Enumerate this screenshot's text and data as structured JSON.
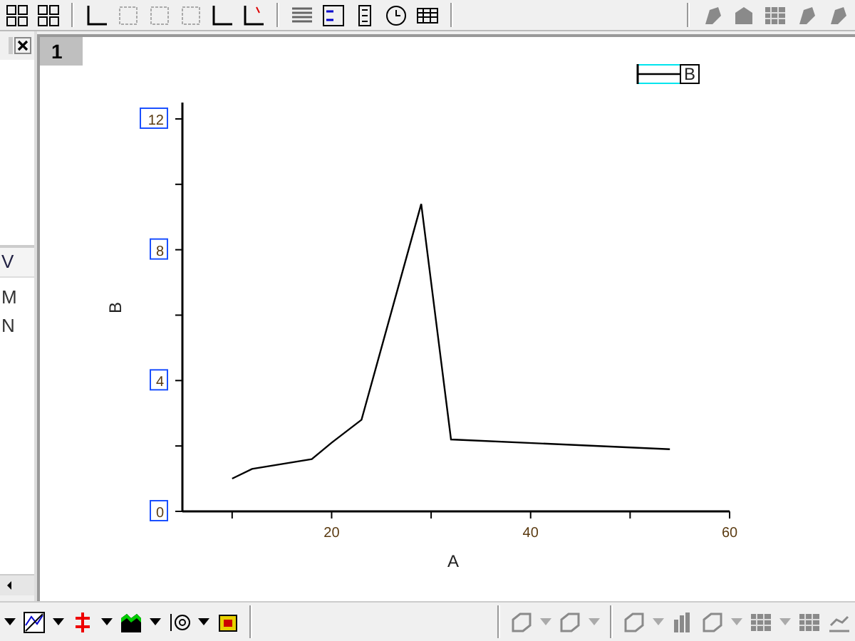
{
  "side_panel": {
    "items": [
      {
        "label": "V",
        "kind": "header"
      },
      {
        "label": "M",
        "kind": "row"
      },
      {
        "label": "N",
        "kind": "row"
      }
    ]
  },
  "graph_window": {
    "tab": "1",
    "chart_data": {
      "type": "line",
      "xlabel": "A",
      "ylabel": "B",
      "x": [
        10,
        12,
        18,
        20,
        23,
        29,
        32,
        54
      ],
      "series": [
        {
          "name": "B",
          "color": "#000000",
          "values": [
            1,
            1.3,
            1.6,
            2.1,
            2.8,
            9.4,
            2.2,
            1.9
          ]
        }
      ],
      "xlim": [
        5,
        60
      ],
      "ylim": [
        0,
        12.5
      ],
      "xticks": [
        20,
        40,
        60
      ],
      "yticks": [
        0,
        4,
        8,
        12
      ]
    }
  }
}
